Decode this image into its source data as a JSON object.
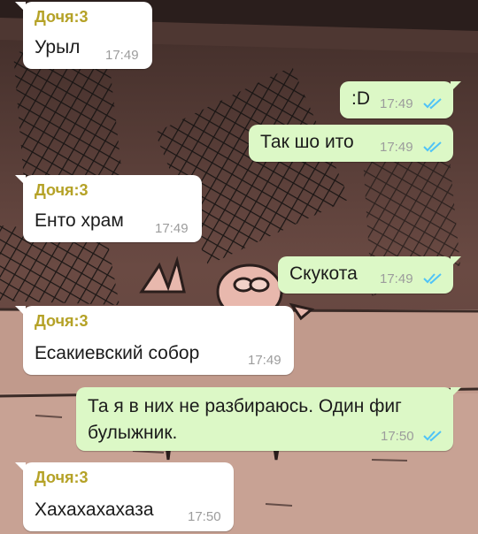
{
  "colors": {
    "sender_name": "#b5a227",
    "incoming_bubble": "#ffffff",
    "outgoing_bubble": "#dcf8c6",
    "read_ticks": "#4fc3f7",
    "timestamp": "#9c9c9c"
  },
  "icons": {
    "read_status": "double-check-icon"
  },
  "messages": [
    {
      "direction": "in",
      "sender": "Дочя:3",
      "text": "Урыл",
      "time": "17:49"
    },
    {
      "direction": "out",
      "text": ":D",
      "time": "17:49",
      "status": "read"
    },
    {
      "direction": "out",
      "text": "Так шо ито",
      "time": "17:49",
      "status": "read"
    },
    {
      "direction": "in",
      "sender": "Дочя:3",
      "text": "Енто храм",
      "time": "17:49"
    },
    {
      "direction": "out",
      "text": "Скукота",
      "time": "17:49",
      "status": "read"
    },
    {
      "direction": "in",
      "sender": "Дочя:3",
      "text": "Есакиевский собор",
      "time": "17:49"
    },
    {
      "direction": "out",
      "text": "Та я в них не разбираюсь. Один фиг булыжник.",
      "time": "17:50",
      "status": "read"
    },
    {
      "direction": "in",
      "sender": "Дочя:3",
      "text": "Хахахахахаза",
      "time": "17:50"
    }
  ]
}
